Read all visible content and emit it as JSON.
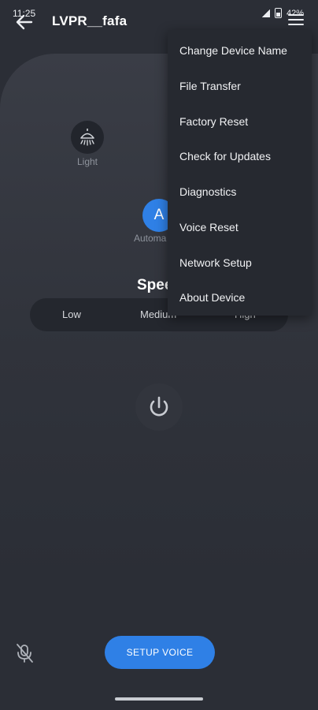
{
  "status_bar": {
    "time": "11:25",
    "battery": "42%"
  },
  "header": {
    "title": "LVPR__fafa"
  },
  "controls": {
    "light_label": "Light",
    "auto_letter": "A",
    "auto_label": "Automa",
    "speed_title": "Spee",
    "speed_options": [
      "Low",
      "Medium",
      "High"
    ]
  },
  "menu": {
    "items": [
      "Change Device Name",
      "File Transfer",
      "Factory Reset",
      "Check for Updates",
      "Diagnostics",
      "Voice Reset",
      "Network Setup",
      "About Device"
    ]
  },
  "footer": {
    "setup_voice_label": "SETUP VOICE"
  },
  "icons": [
    "back-arrow-icon",
    "menu-icon",
    "light-bulb-icon",
    "power-icon",
    "mic-off-icon"
  ],
  "colors": {
    "background": "#2b2e36",
    "accent": "#2f80e6",
    "menu_bg": "#262930"
  }
}
